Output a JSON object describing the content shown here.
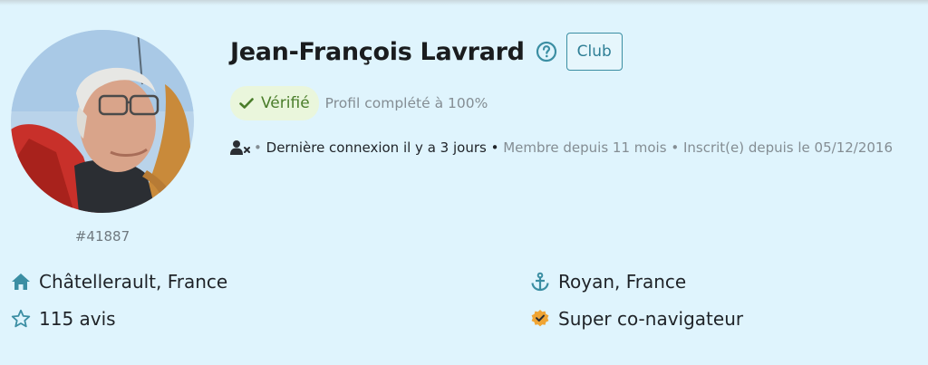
{
  "profile": {
    "name": "Jean-François Lavrard",
    "club_label": "Club",
    "member_id": "#41887",
    "verified_label": "Vérifié",
    "profile_complete": "Profil complété à 100%"
  },
  "activity": {
    "bullet": "•",
    "last_login": "Dernière connexion il y a 3 jours",
    "member_since": "Membre depuis 11 mois",
    "registered": "Inscrit(e) depuis le 05/12/2016"
  },
  "info": {
    "city": "Châtellerault, France",
    "reviews": "115 avis",
    "home_port": "Royan, France",
    "badge": "Super co-navigateur"
  },
  "icons": {
    "help": "question-circle-icon",
    "check": "check-icon",
    "user_x": "user-x-icon",
    "home": "home-icon",
    "star": "star-icon",
    "anchor": "anchor-icon",
    "badge": "verified-badge-icon"
  },
  "colors": {
    "background": "#dff4fd",
    "accent": "#3b8ea3",
    "verified_bg": "#eaf6dc",
    "verified_text": "#4a7d2a",
    "badge_orange": "#f0a534"
  }
}
